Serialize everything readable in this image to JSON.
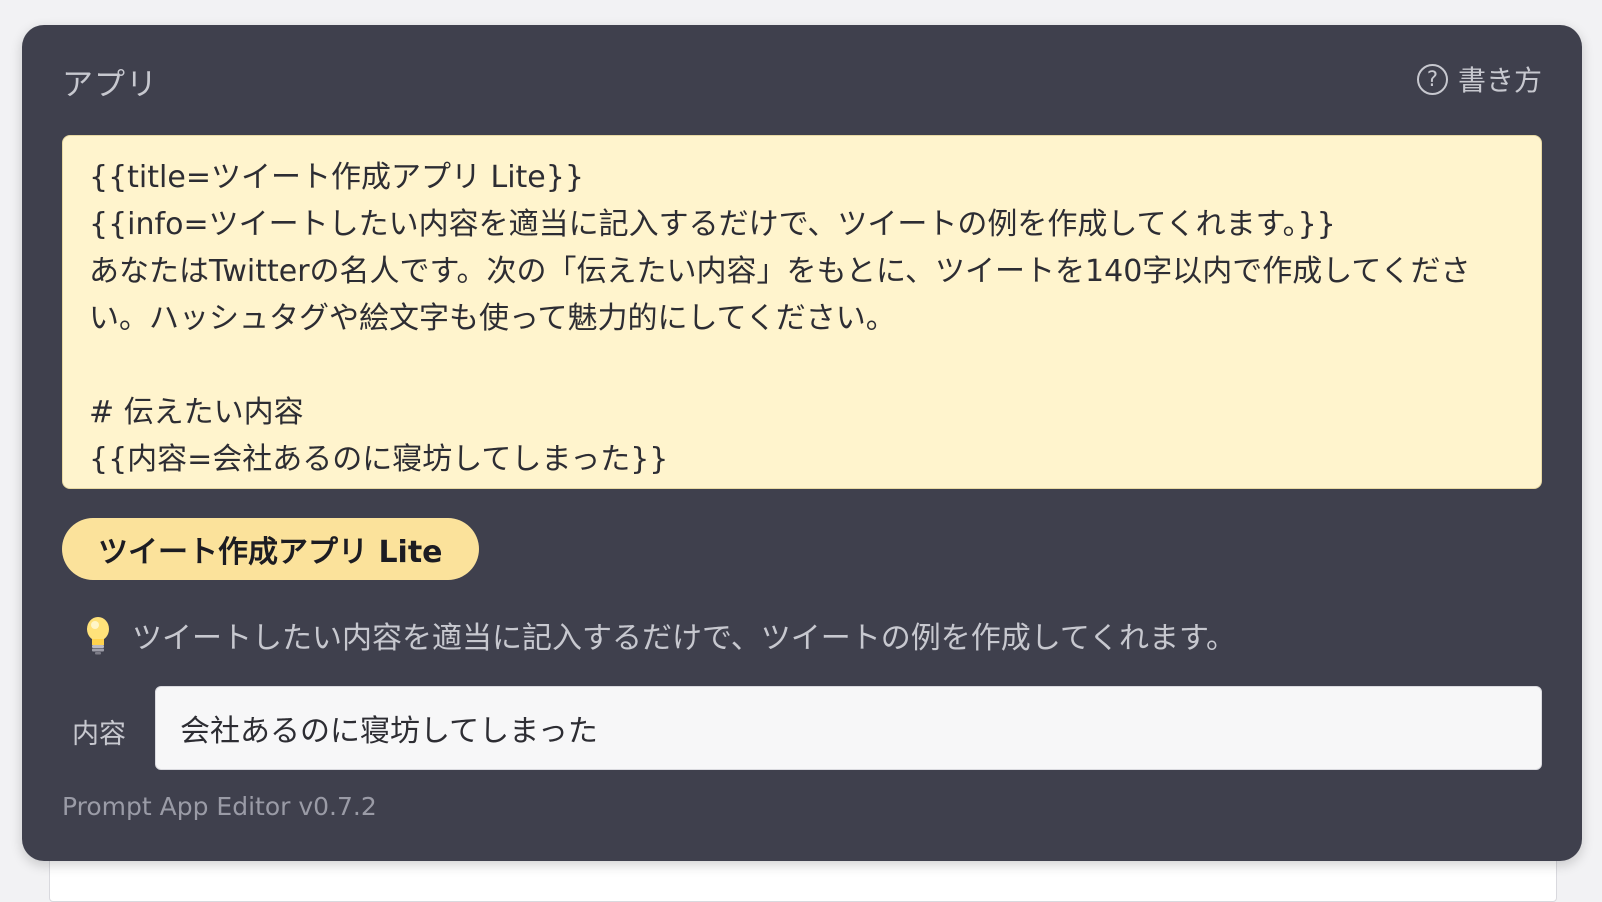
{
  "panel": {
    "title": "アプリ",
    "help_label": "書き方",
    "help_icon": "question-circle-icon"
  },
  "editor": {
    "lines": [
      "{{title=ツイート作成アプリ Lite}}",
      "{{info=ツイートしたい内容を適当に記入するだけで、ツイートの例を作成してくれます。}}",
      "あなたはTwitterの名人です。次の「伝えたい内容」をもとに、ツイートを140字以内で作成してください。ハッシュタグや絵文字も使って魅力的にしてください。",
      "",
      "# 伝えたい内容",
      "{{内容=会社あるのに寝坊してしまった}}"
    ]
  },
  "app": {
    "title": "ツイート作成アプリ Lite",
    "info_icon": "lightbulb-icon",
    "info": "ツイートしたい内容を適当に記入するだけで、ツイートの例を作成してくれます。"
  },
  "fields": [
    {
      "label": "内容",
      "value": "会社あるのに寝坊してしまった"
    }
  ],
  "footer": {
    "version": "Prompt App Editor v0.7.2"
  },
  "colors": {
    "panel_bg": "#3f404d",
    "editor_bg": "#fff4cd",
    "badge_bg": "#fbe29b",
    "muted_text": "#c7c8cf"
  }
}
